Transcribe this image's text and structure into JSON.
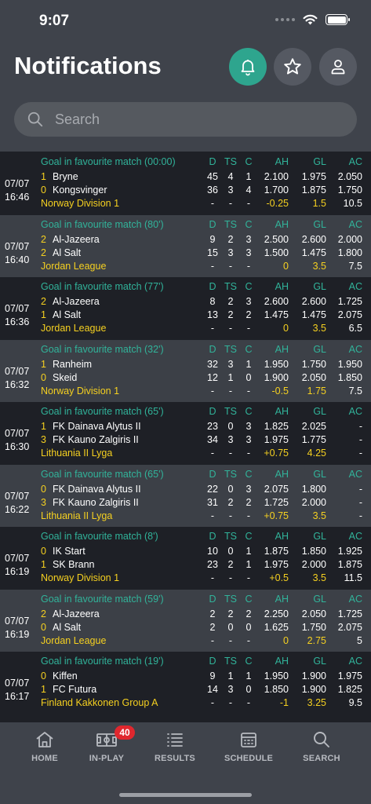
{
  "status": {
    "time": "9:07"
  },
  "header": {
    "title": "Notifications"
  },
  "search": {
    "placeholder": "Search"
  },
  "col_headers": {
    "d": "D",
    "ts": "TS",
    "c": "C",
    "ah": "AH",
    "gl": "GL",
    "ac": "AC"
  },
  "notifications": [
    {
      "title": "Goal in favourite match (00:00)",
      "date": "07/07",
      "time": "16:46",
      "home": {
        "score": "1",
        "name": "Bryne",
        "d": "45",
        "ts": "4",
        "c": "1",
        "ah": "2.100",
        "gl": "1.975",
        "ac": "2.050"
      },
      "away": {
        "score": "0",
        "name": "Kongsvinger",
        "d": "36",
        "ts": "3",
        "c": "4",
        "ah": "1.700",
        "gl": "1.875",
        "ac": "1.750"
      },
      "league": "Norway Division 1",
      "line": {
        "d": "-",
        "ts": "-",
        "c": "-",
        "ah": "-0.25",
        "gl": "1.5",
        "ac": "10.5"
      }
    },
    {
      "title": "Goal in favourite match (80')",
      "date": "07/07",
      "time": "16:40",
      "home": {
        "score": "2",
        "name": "Al-Jazeera",
        "d": "9",
        "ts": "2",
        "c": "3",
        "ah": "2.500",
        "gl": "2.600",
        "ac": "2.000"
      },
      "away": {
        "score": "2",
        "name": "Al Salt",
        "d": "15",
        "ts": "3",
        "c": "3",
        "ah": "1.500",
        "gl": "1.475",
        "ac": "1.800"
      },
      "league": "Jordan League",
      "line": {
        "d": "-",
        "ts": "-",
        "c": "-",
        "ah": "0",
        "gl": "3.5",
        "ac": "7.5"
      }
    },
    {
      "title": "Goal in favourite match (77')",
      "date": "07/07",
      "time": "16:36",
      "home": {
        "score": "2",
        "name": "Al-Jazeera",
        "d": "8",
        "ts": "2",
        "c": "3",
        "ah": "2.600",
        "gl": "2.600",
        "ac": "1.725"
      },
      "away": {
        "score": "1",
        "name": "Al Salt",
        "d": "13",
        "ts": "2",
        "c": "2",
        "ah": "1.475",
        "gl": "1.475",
        "ac": "2.075"
      },
      "league": "Jordan League",
      "line": {
        "d": "-",
        "ts": "-",
        "c": "-",
        "ah": "0",
        "gl": "3.5",
        "ac": "6.5"
      }
    },
    {
      "title": "Goal in favourite match (32')",
      "date": "07/07",
      "time": "16:32",
      "home": {
        "score": "1",
        "name": "Ranheim",
        "d": "32",
        "ts": "3",
        "c": "1",
        "ah": "1.950",
        "gl": "1.750",
        "ac": "1.950"
      },
      "away": {
        "score": "0",
        "name": "Skeid",
        "d": "12",
        "ts": "1",
        "c": "0",
        "ah": "1.900",
        "gl": "2.050",
        "ac": "1.850"
      },
      "league": "Norway Division 1",
      "line": {
        "d": "-",
        "ts": "-",
        "c": "-",
        "ah": "-0.5",
        "gl": "1.75",
        "ac": "7.5"
      }
    },
    {
      "title": "Goal in favourite match (65')",
      "date": "07/07",
      "time": "16:30",
      "home": {
        "score": "1",
        "name": "FK Dainava Alytus II",
        "d": "23",
        "ts": "0",
        "c": "3",
        "ah": "1.825",
        "gl": "2.025",
        "ac": "-"
      },
      "away": {
        "score": "3",
        "name": "FK Kauno Zalgiris II",
        "d": "34",
        "ts": "3",
        "c": "3",
        "ah": "1.975",
        "gl": "1.775",
        "ac": "-"
      },
      "league": "Lithuania II Lyga",
      "line": {
        "d": "-",
        "ts": "-",
        "c": "-",
        "ah": "+0.75",
        "gl": "4.25",
        "ac": "-"
      }
    },
    {
      "title": "Goal in favourite match (65')",
      "date": "07/07",
      "time": "16:22",
      "home": {
        "score": "0",
        "name": "FK Dainava Alytus II",
        "d": "22",
        "ts": "0",
        "c": "3",
        "ah": "2.075",
        "gl": "1.800",
        "ac": "-"
      },
      "away": {
        "score": "3",
        "name": "FK Kauno Zalgiris II",
        "d": "31",
        "ts": "2",
        "c": "2",
        "ah": "1.725",
        "gl": "2.000",
        "ac": "-"
      },
      "league": "Lithuania II Lyga",
      "line": {
        "d": "-",
        "ts": "-",
        "c": "-",
        "ah": "+0.75",
        "gl": "3.5",
        "ac": "-"
      }
    },
    {
      "title": "Goal in favourite match (8')",
      "date": "07/07",
      "time": "16:19",
      "home": {
        "score": "0",
        "name": "IK Start",
        "d": "10",
        "ts": "0",
        "c": "1",
        "ah": "1.875",
        "gl": "1.850",
        "ac": "1.925"
      },
      "away": {
        "score": "1",
        "name": "SK Brann",
        "d": "23",
        "ts": "2",
        "c": "1",
        "ah": "1.975",
        "gl": "2.000",
        "ac": "1.875"
      },
      "league": "Norway Division 1",
      "line": {
        "d": "-",
        "ts": "-",
        "c": "-",
        "ah": "+0.5",
        "gl": "3.5",
        "ac": "11.5"
      }
    },
    {
      "title": "Goal in favourite match (59')",
      "date": "07/07",
      "time": "16:19",
      "home": {
        "score": "2",
        "name": "Al-Jazeera",
        "d": "2",
        "ts": "2",
        "c": "2",
        "ah": "2.250",
        "gl": "2.050",
        "ac": "1.725"
      },
      "away": {
        "score": "0",
        "name": "Al Salt",
        "d": "2",
        "ts": "0",
        "c": "0",
        "ah": "1.625",
        "gl": "1.750",
        "ac": "2.075"
      },
      "league": "Jordan League",
      "line": {
        "d": "-",
        "ts": "-",
        "c": "-",
        "ah": "0",
        "gl": "2.75",
        "ac": "5"
      }
    },
    {
      "title": "Goal in favourite match (19')",
      "date": "07/07",
      "time": "16:17",
      "home": {
        "score": "0",
        "name": "Kiffen",
        "d": "9",
        "ts": "1",
        "c": "1",
        "ah": "1.950",
        "gl": "1.900",
        "ac": "1.975"
      },
      "away": {
        "score": "1",
        "name": "FC Futura",
        "d": "14",
        "ts": "3",
        "c": "0",
        "ah": "1.850",
        "gl": "1.900",
        "ac": "1.825"
      },
      "league": "Finland Kakkonen Group A",
      "line": {
        "d": "-",
        "ts": "-",
        "c": "-",
        "ah": "-1",
        "gl": "3.25",
        "ac": "9.5"
      }
    }
  ],
  "tabbar": {
    "home": "HOME",
    "inplay": "IN-PLAY",
    "inplay_badge": "40",
    "results": "RESULTS",
    "schedule": "SCHEDULE",
    "search": "SEARCH"
  },
  "colors": {
    "accent": "#2ea58e",
    "league": "#f5d020",
    "badge": "#e0272e"
  }
}
